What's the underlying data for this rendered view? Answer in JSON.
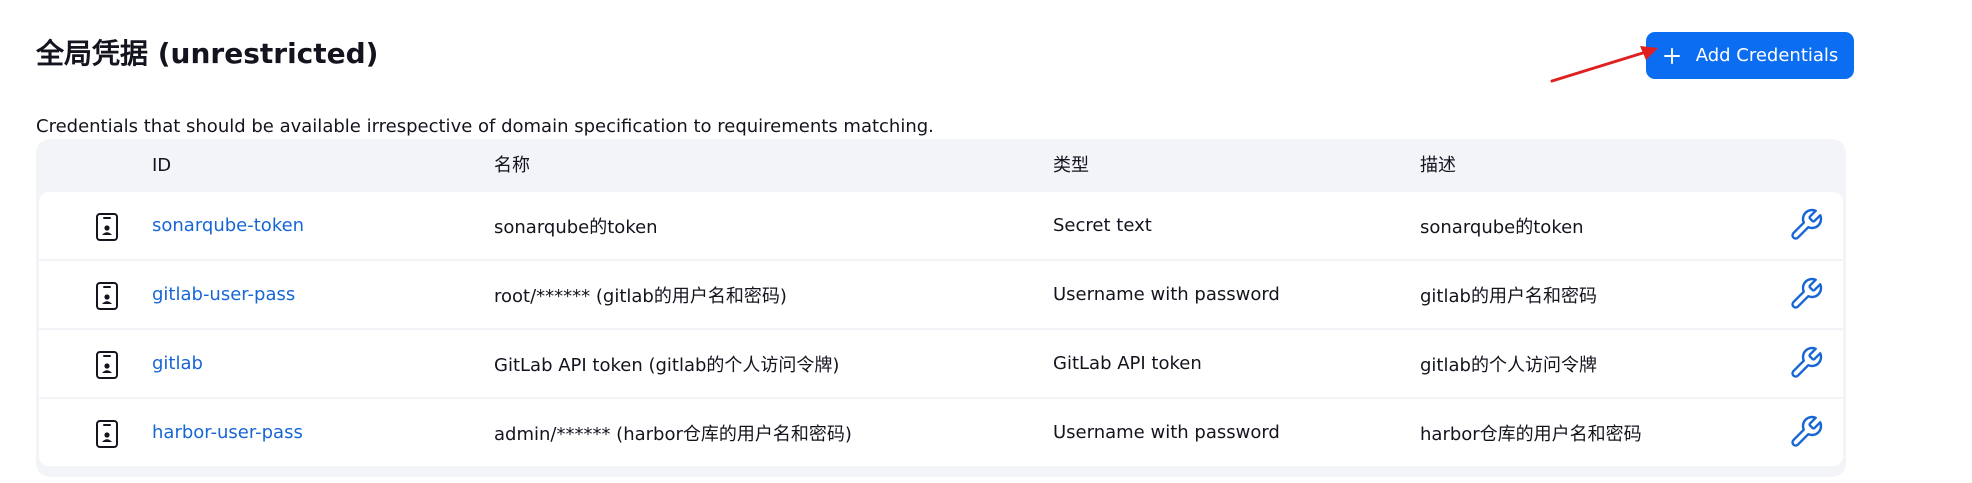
{
  "header": {
    "title": "全局凭据 (unrestricted)",
    "add_button_label": "Add Credentials",
    "add_button_icon": "plus-icon",
    "annotation_arrow_color": "#e02020"
  },
  "description": "Credentials that should be available irrespective of domain specification to requirements matching.",
  "table": {
    "columns": [
      "",
      "ID",
      "名称",
      "类型",
      "描述",
      ""
    ],
    "rows": [
      {
        "icon": "credential-card-icon",
        "id": "sonarqube-token",
        "name": "sonarqube的token",
        "type": "Secret text",
        "description": "sonarqube的token",
        "action_icon": "wrench-icon"
      },
      {
        "icon": "credential-card-icon",
        "id": "gitlab-user-pass",
        "name": "root/****** (gitlab的用户名和密码)",
        "type": "Username with password",
        "description": "gitlab的用户名和密码",
        "action_icon": "wrench-icon"
      },
      {
        "icon": "credential-card-icon",
        "id": "gitlab",
        "name": "GitLab API token (gitlab的个人访问令牌)",
        "type": "GitLab API token",
        "description": "gitlab的个人访问令牌",
        "action_icon": "wrench-icon"
      },
      {
        "icon": "credential-card-icon",
        "id": "harbor-user-pass",
        "name": "admin/****** (harbor仓库的用户名和密码)",
        "type": "Username with password",
        "description": "harbor仓库的用户名和密码",
        "action_icon": "wrench-icon"
      }
    ]
  },
  "colors": {
    "accent": "#0b6ef2",
    "link": "#1766d6",
    "table_bg": "#f2f4f7"
  }
}
